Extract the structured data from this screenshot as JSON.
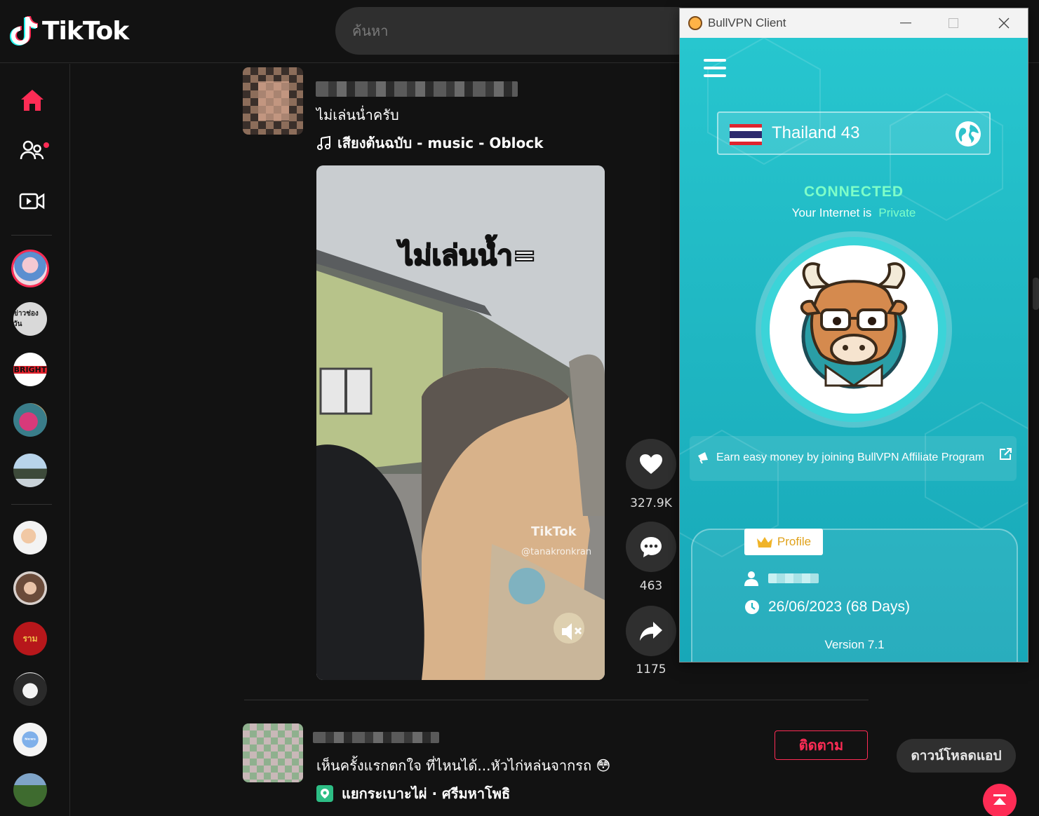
{
  "tiktok": {
    "logo_text": "TikTok",
    "search_placeholder": "ค้นหา",
    "post1": {
      "caption": "ไม่เล่นน่ำครับ",
      "music": "เสียงต้นฉบับ - music - Oblock",
      "video_overlay_text": "ไม่เล่นน้ำ=",
      "watermark_logo": "TikTok",
      "watermark_user": "@tanakronkran",
      "likes": "327.9K",
      "comments": "463",
      "shares": "1175"
    },
    "post2": {
      "caption": "เห็นครั้งแรกตกใจ ที่ไหนได้...หัวไก่หล่นจากรถ 😳",
      "location": "แยกระเบาะไผ่ · ศรีมหาโพธิ",
      "follow_label": "ติดตาม"
    },
    "download_app_label": "ดาวน์โหลดแอป",
    "sidebar_avatars": [
      {
        "label": ""
      },
      {
        "label": "ข่าวช่องวัน"
      },
      {
        "label": "BRIGHT"
      },
      {
        "label": ""
      },
      {
        "label": ""
      },
      {
        "label": ""
      },
      {
        "label": ""
      },
      {
        "label": "ราม"
      },
      {
        "label": ""
      },
      {
        "label": "ᴺᵉʷˢ"
      },
      {
        "label": ""
      }
    ]
  },
  "vpn": {
    "window_title": "BullVPN Client",
    "server_name": "Thailand 43",
    "status": "CONNECTED",
    "status_sub_prefix": "Your Internet is",
    "status_sub_value": "Private",
    "affiliate_text": "Earn easy money by joining BullVPN Affiliate Program",
    "profile_tab_label": "Profile",
    "expiry": "26/06/2023 (68 Days)",
    "version": "Version 7.1"
  },
  "colors": {
    "tiktok_accent": "#fe2c55",
    "vpn_teal": "#1fb6c2",
    "vpn_status_green": "#7effc8"
  }
}
